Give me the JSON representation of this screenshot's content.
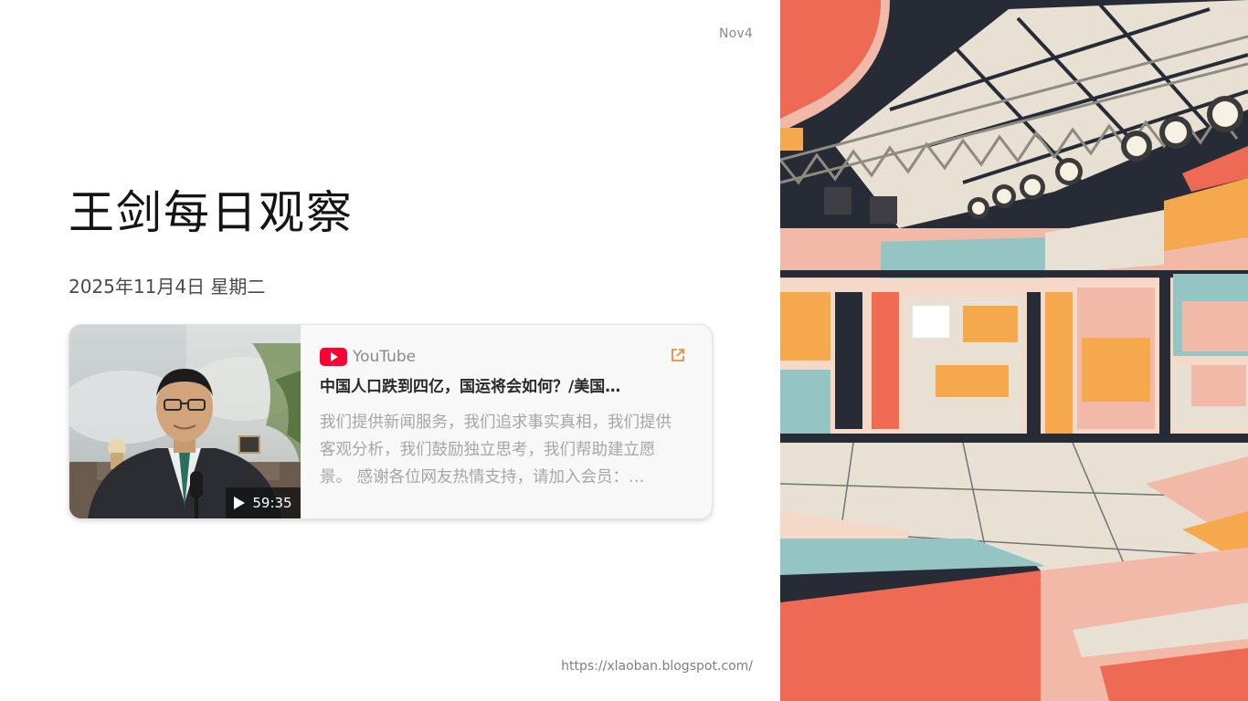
{
  "slide": {
    "date_badge": "Nov4",
    "title": "王剑每日观察",
    "subtitle": "2025年11月4日 星期二",
    "url": "https://xlaoban.blogspot.com/"
  },
  "video_card": {
    "source": "YouTube",
    "source_icon": "youtube-icon",
    "title": "中国人口跌到四亿，国运将会如何？/美国…",
    "description": "我们提供新闻服务，我们追求事实真相，我们提供客观分析，我们鼓励独立思考，我们帮助建立愿景。 感谢各位网友热情支持，请加入会员：…",
    "duration": "59:35",
    "link_icon": "external-link-icon"
  },
  "colors": {
    "youtube_red": "#ff0033",
    "accent_orange": "#f08a3c",
    "title_text": "#141414"
  }
}
